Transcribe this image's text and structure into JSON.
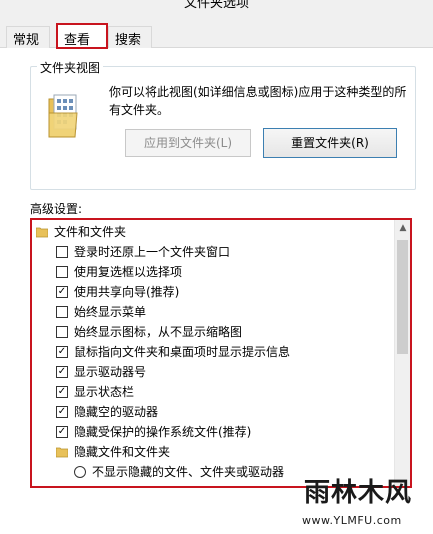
{
  "window": {
    "title": "文件夹选项"
  },
  "tabs": [
    {
      "label": "常规"
    },
    {
      "label": "查看"
    },
    {
      "label": "搜索"
    }
  ],
  "folder_views": {
    "legend": "文件夹视图",
    "description": "你可以将此视图(如详细信息或图标)应用于这种类型的所有文件夹。",
    "apply_label": "应用到文件夹(L)",
    "reset_label": "重置文件夹(R)"
  },
  "advanced": {
    "label": "高级设置:",
    "items": [
      {
        "type": "folder",
        "label": "文件和文件夹"
      },
      {
        "type": "checkbox",
        "checked": false,
        "label": "登录时还原上一个文件夹窗口"
      },
      {
        "type": "checkbox",
        "checked": false,
        "label": "使用复选框以选择项"
      },
      {
        "type": "checkbox",
        "checked": true,
        "label": "使用共享向导(推荐)"
      },
      {
        "type": "checkbox",
        "checked": false,
        "label": "始终显示菜单"
      },
      {
        "type": "checkbox",
        "checked": false,
        "label": "始终显示图标，从不显示缩略图"
      },
      {
        "type": "checkbox",
        "checked": true,
        "label": "鼠标指向文件夹和桌面项时显示提示信息"
      },
      {
        "type": "checkbox",
        "checked": true,
        "label": "显示驱动器号"
      },
      {
        "type": "checkbox",
        "checked": true,
        "label": "显示状态栏"
      },
      {
        "type": "checkbox",
        "checked": true,
        "label": "隐藏空的驱动器"
      },
      {
        "type": "checkbox",
        "checked": true,
        "label": "隐藏受保护的操作系统文件(推荐)"
      },
      {
        "type": "folder",
        "label": "隐藏文件和文件夹"
      },
      {
        "type": "radio",
        "checked": false,
        "label": "不显示隐藏的文件、文件夹或驱动器"
      }
    ]
  },
  "watermark": {
    "brand": "雨林木风",
    "url": "www.YLMFU.com"
  },
  "colors": {
    "highlight_border": "#c8141e",
    "folder_yellow": "#e8c15a"
  },
  "icons": {
    "folder": "folder-icon",
    "folder_view": "folder-view-icon",
    "scroll_up": "chevron-up-icon"
  }
}
